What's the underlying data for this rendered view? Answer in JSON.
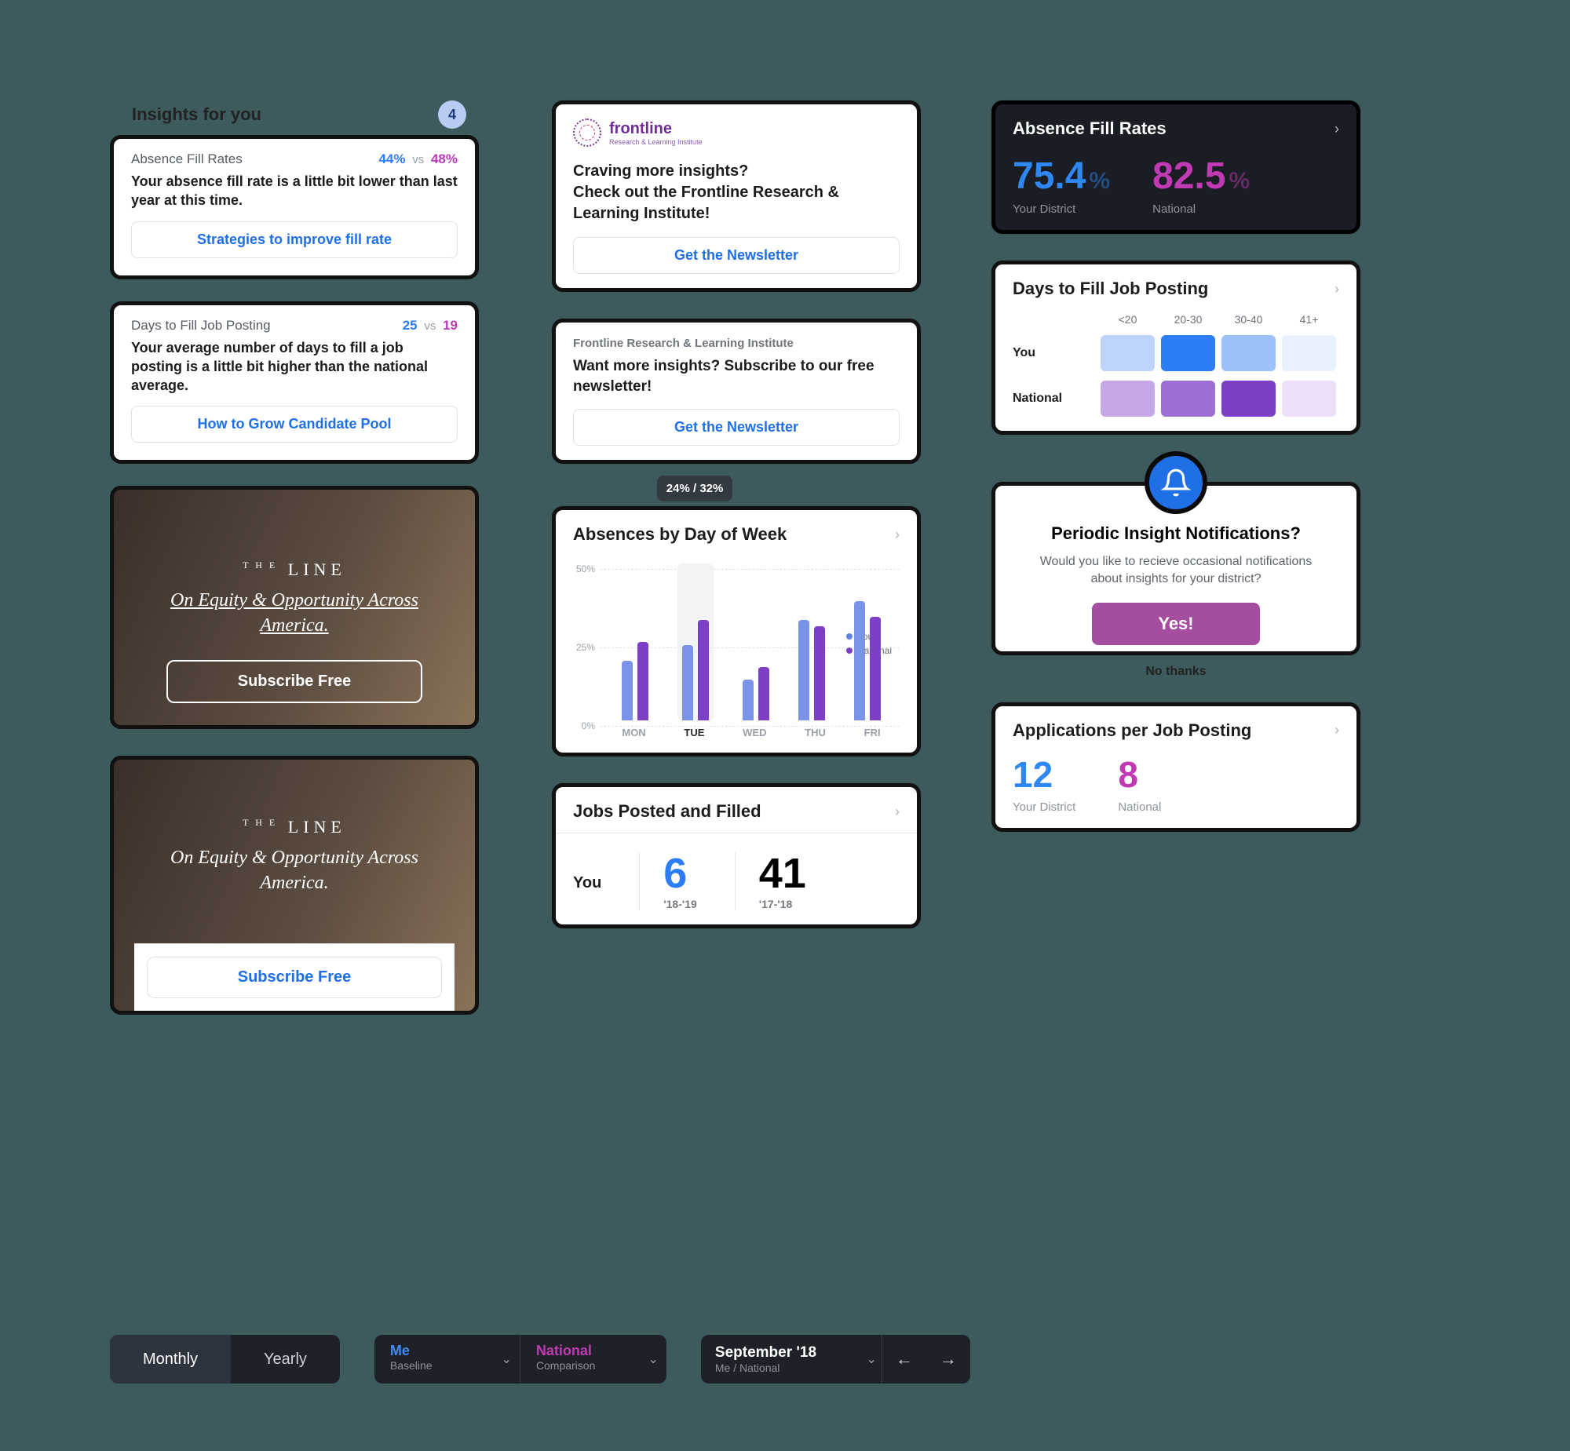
{
  "insights": {
    "header": "Insights for you",
    "count": "4",
    "cards": [
      {
        "title": "Absence Fill Rates",
        "a": "44%",
        "b": "48%",
        "vs": "vs",
        "body": "Your absence fill rate is a little bit lower than last year at this time.",
        "cta": "Strategies to improve fill rate"
      },
      {
        "title": "Days to Fill Job Posting",
        "a": "25",
        "b": "19",
        "vs": "vs",
        "body": "Your average number of days to fill a job posting is a little bit higher than the national average.",
        "cta": "How to Grow Candidate Pool"
      }
    ]
  },
  "line": {
    "logo_small": "T H E",
    "logo": "LINE",
    "tagline": "On Equity & Opportunity Across America.",
    "cta": "Subscribe Free"
  },
  "frontline": {
    "brand": "frontline",
    "brand_sub": "Research & Learning Institute",
    "body1": "Craving more insights?\nCheck out the Frontline Research & Learning Institute!",
    "label": "Frontline Research & Learning Institute",
    "body2": "Want more insights? Subscribe to our free newsletter!",
    "cta": "Get the Newsletter"
  },
  "abs_chart": {
    "title": "Absences by Day of Week",
    "tooltip": "24% / 32%",
    "legend_you": "You",
    "legend_nat": "National",
    "yTicks": [
      "50%",
      "25%",
      "0%"
    ]
  },
  "chart_data": {
    "type": "bar",
    "title": "Absences by Day of Week",
    "categories": [
      "MON",
      "TUE",
      "WED",
      "THU",
      "FRI"
    ],
    "series": [
      {
        "name": "You",
        "values": [
          19,
          24,
          13,
          32,
          38
        ]
      },
      {
        "name": "National",
        "values": [
          25,
          32,
          17,
          30,
          33
        ]
      }
    ],
    "ylabel": "",
    "xlabel": "",
    "ylim": [
      0,
      50
    ],
    "highlight_index": 1
  },
  "jobs": {
    "title": "Jobs Posted and Filled",
    "you_label": "You",
    "vals": [
      {
        "n": "6",
        "cap": "'18-'19"
      },
      {
        "n": "41",
        "cap": "'17-'18"
      }
    ]
  },
  "fillrates": {
    "title": "Absence Fill Rates",
    "a": {
      "v": "75.4",
      "pct": "%",
      "cap": "Your District"
    },
    "b": {
      "v": "82.5",
      "pct": "%",
      "cap": "National"
    }
  },
  "daysfill": {
    "title": "Days to Fill Job Posting",
    "buckets": [
      "<20",
      "20-30",
      "30-40",
      "41+"
    ],
    "rows": [
      "You",
      "National"
    ],
    "colors": {
      "you": [
        "#bcd4fb",
        "#2d7df6",
        "#9cc0f8",
        "#e9f0fd"
      ],
      "nat": [
        "#c6a8e7",
        "#9c6fd4",
        "#7c3fc5",
        "#ecdff8"
      ]
    }
  },
  "notify": {
    "title": "Periodic Insight Notifications?",
    "body": "Would you like to recieve occasional notifications about insights for your district?",
    "yes": "Yes!",
    "no": "No thanks"
  },
  "apps": {
    "title": "Applications per Job Posting",
    "a": {
      "v": "12",
      "cap": "Your District"
    },
    "b": {
      "v": "8",
      "cap": "National"
    }
  },
  "controls": {
    "seg": [
      "Monthly",
      "Yearly"
    ],
    "pick1": {
      "t": "Me",
      "s": "Baseline"
    },
    "pick2": {
      "t": "National",
      "s": "Comparison"
    },
    "date": {
      "t": "September '18",
      "s": "Me / National"
    }
  }
}
